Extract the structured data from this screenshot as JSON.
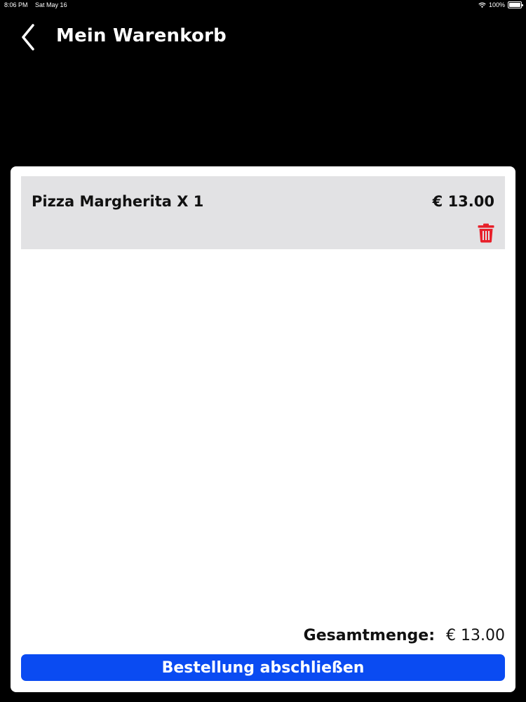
{
  "status_bar": {
    "time": "8:06 PM",
    "date": "Sat May 16",
    "battery": "100%",
    "battery_level": 1.0,
    "wifi_icon": "wifi-icon",
    "battery_icon": "battery-icon"
  },
  "header": {
    "title": "Mein Warenkorb",
    "back_icon": "chevron-left-icon"
  },
  "cart": {
    "items": [
      {
        "name": "Pizza Margherita X 1",
        "price": "€ 13.00",
        "delete_icon": "trash-icon"
      }
    ],
    "total_label": "Gesamtmenge:",
    "total_value": "€ 13.00",
    "checkout_label": "Bestellung abschließen"
  },
  "colors": {
    "background": "#000000",
    "card": "#ffffff",
    "item_background": "#e2e2e4",
    "accent": "#0a4bf2",
    "delete": "#e8202a"
  }
}
